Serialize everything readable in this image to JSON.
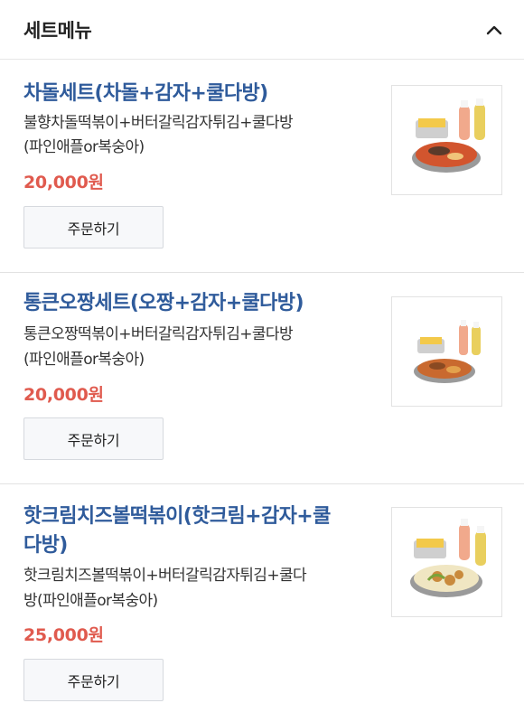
{
  "section": {
    "title": "세트메뉴",
    "collapse_icon": "chevron-up-icon"
  },
  "items": [
    {
      "name": "차돌세트(차돌+감자+쿨다방)",
      "desc_line1": "불향차돌떡볶이+버터갈릭감자튀김+쿨다방",
      "desc_line2": "(파인애플or복숭아)",
      "price": "20,000원",
      "order_label": "주문하기"
    },
    {
      "name": "통큰오짱세트(오짱+감자+쿨다방)",
      "desc_line1": "통큰오짱떡볶이+버터갈릭감자튀김+쿨다방",
      "desc_line2": "(파인애플or복숭아)",
      "price": "20,000원",
      "order_label": "주문하기"
    },
    {
      "name_line1": "핫크림치즈볼떡볶이(핫크림+감자+쿨",
      "name_line2": "다방)",
      "desc_line1": "핫크림치즈볼떡볶이+버터갈릭감자튀김+쿨다",
      "desc_line2": "방(파인애플or복숭아)",
      "price": "25,000원",
      "order_label": "주문하기"
    }
  ],
  "colors": {
    "name": "#2f5b9b",
    "price": "#e05a4e",
    "button_bg": "#f7f8fa"
  }
}
